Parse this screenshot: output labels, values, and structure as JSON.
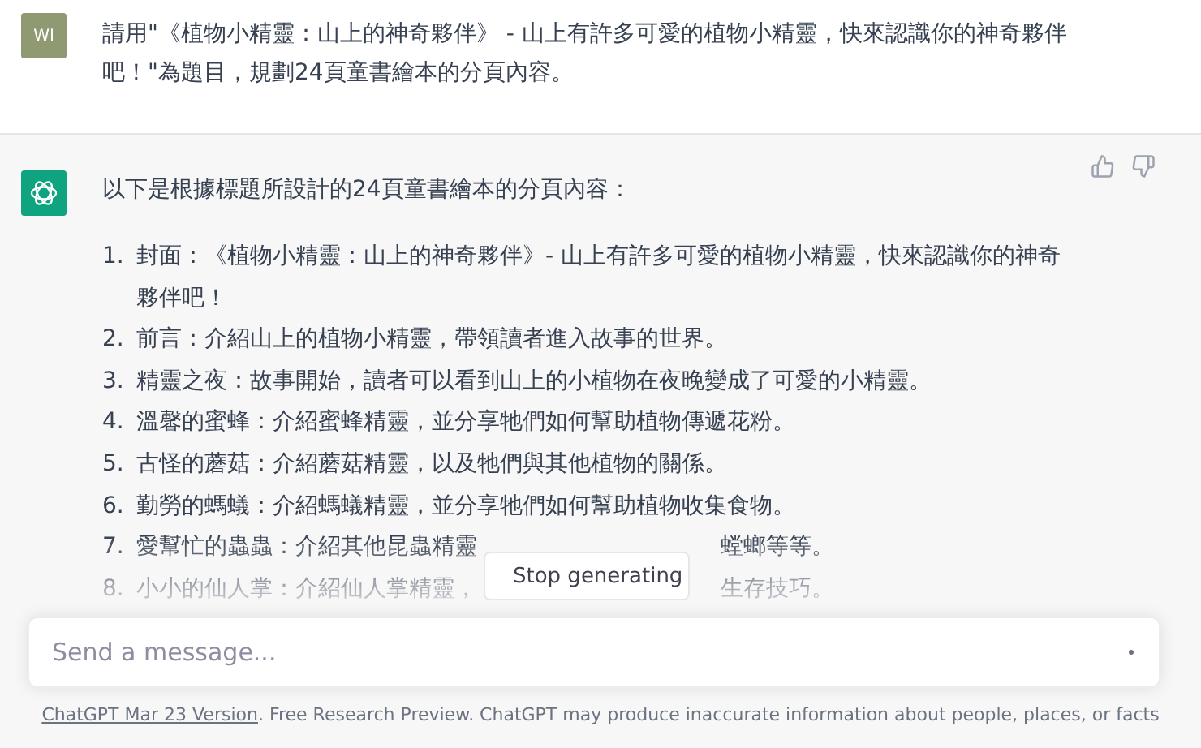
{
  "user_message": {
    "avatar": "WI",
    "text": "請用\"《植物小精靈：山上的神奇夥伴》 - 山上有許多可愛的植物小精靈，快來認識你的神奇夥伴吧！\"為題目，規劃24頁童書繪本的分頁內容。"
  },
  "assistant_message": {
    "intro": "以下是根據標題所設計的24頁童書繪本的分頁內容：",
    "items": [
      {
        "number": "1.",
        "segments": [
          "封面：《植物小精靈：山上的神奇夥伴》- 山上有許多可愛的植物小精靈，快來認識你的神奇夥伴吧！"
        ]
      },
      {
        "number": "2.",
        "segments": [
          "前言：介紹山上的植物小精靈，帶領讀者進入故事的世界。"
        ]
      },
      {
        "number": "3.",
        "segments": [
          "精靈之夜：故事開始，讀者可以看到山上的小植物在夜晚變成了可愛的小精靈。"
        ]
      },
      {
        "number": "4.",
        "segments": [
          "溫馨的蜜蜂：介紹蜜蜂精靈，並分享牠們如何幫助植物傳遞花粉。"
        ]
      },
      {
        "number": "5.",
        "segments": [
          "古怪的蘑菇：介紹蘑菇精靈，以及牠們與其他植物的關係。"
        ]
      },
      {
        "number": "6.",
        "segments": [
          "勤勞的螞蟻：介紹螞蟻精靈，並分享牠們如何幫助植物收集食物。"
        ]
      },
      {
        "number": "7.",
        "segments": [
          "愛幫忙的蟲蟲：介紹其他昆蟲精靈",
          "螳螂等等。"
        ]
      },
      {
        "number": "8.",
        "segments": [
          "小小的仙人掌：介紹仙人掌精靈，",
          "生存技巧。"
        ]
      }
    ]
  },
  "stop_button": {
    "label": "Stop generating"
  },
  "composer": {
    "placeholder": "Send a message..."
  },
  "footer": {
    "link": "ChatGPT Mar 23 Version",
    "text": ". Free Research Preview. ChatGPT may produce inaccurate information about people, places, or facts"
  }
}
